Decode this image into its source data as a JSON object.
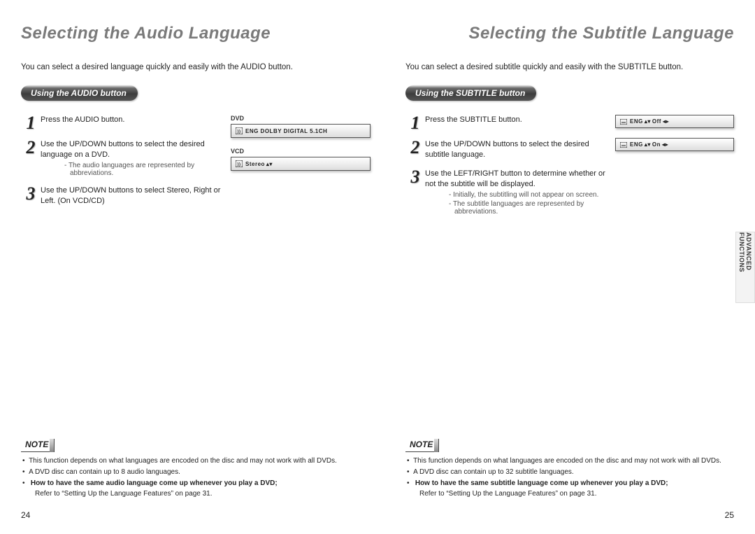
{
  "left": {
    "title": "Selecting the Audio Language",
    "intro": "You can select a desired language quickly and easily with the AUDIO button.",
    "pill": "Using the AUDIO button",
    "steps": [
      {
        "n": "1",
        "text": "Press the AUDIO button."
      },
      {
        "n": "2",
        "text": "Use the UP/DOWN buttons to select the desired language on a DVD.",
        "sub": "The audio languages are represented by abbreviations."
      },
      {
        "n": "3",
        "text": "Use the UP/DOWN buttons to select Stereo, Right or Left. (On VCD/CD)"
      }
    ],
    "osd": [
      {
        "label": "DVD",
        "text": "ENG  DOLBY  DIGITAL  5.1CH",
        "arrows": "ud"
      },
      {
        "label": "VCD",
        "text": "Stereo",
        "arrows": "ud"
      }
    ],
    "noteLabel": "NOTE",
    "notes": [
      "This function depends on what languages are encoded on the disc and may not work with all DVDs.",
      "A DVD disc can contain up to 8 audio languages."
    ],
    "noteBold": "How to have the same audio language come up whenever you play a DVD;",
    "noteBoldSub": "Refer to “Setting Up the Language Features” on page 31.",
    "pageNumber": "24"
  },
  "right": {
    "title": "Selecting the Subtitle Language",
    "intro": "You can select a desired subtitle quickly and easily with the SUBTITLE button.",
    "pill": "Using the SUBTITLE button",
    "steps": [
      {
        "n": "1",
        "text": "Press the SUBTITLE button."
      },
      {
        "n": "2",
        "text": "Use the UP/DOWN buttons to select the desired subtitle language."
      },
      {
        "n": "3",
        "text": "Use the LEFT/RIGHT button to determine whether or not the subtitle will be displayed.",
        "sub2": [
          "Initially, the subtitling will not appear on screen.",
          "The subtitle languages are represented by abbreviations."
        ]
      }
    ],
    "osd": [
      {
        "text": "ENG",
        "state": "Off",
        "arrows": "udlr"
      },
      {
        "text": "ENG",
        "state": "On",
        "arrows": "udlr"
      }
    ],
    "noteLabel": "NOTE",
    "notes": [
      "This function depends on what languages are encoded on the disc and may not work with all DVDs.",
      "A DVD disc can contain up to 32 subtitle languages."
    ],
    "noteBold": "How to have the same subtitle language come up whenever you play a DVD;",
    "noteBoldSub": "Refer to “Setting Up the Language Features” on page 31.",
    "pageNumber": "25",
    "sideTab": "ADVANCED FUNCTIONS"
  }
}
